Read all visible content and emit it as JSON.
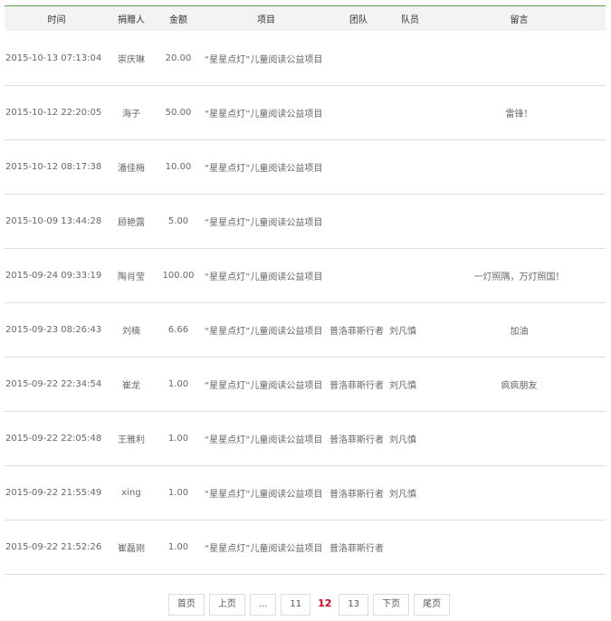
{
  "table": {
    "headers": {
      "time": "时间",
      "donor": "捐赠人",
      "amount": "金额",
      "project": "项目",
      "team": "团队",
      "member": "队员",
      "message": "留言"
    },
    "rows": [
      {
        "time": "2015-10-13 07:13:04",
        "donor": "崇庆琳",
        "amount": "20.00",
        "project": "“星星点灯”儿童阅读公益项目",
        "team": "",
        "member": "",
        "message": ""
      },
      {
        "time": "2015-10-12 22:20:05",
        "donor": "海子",
        "amount": "50.00",
        "project": "“星星点灯”儿童阅读公益项目",
        "team": "",
        "member": "",
        "message": "雷锋！"
      },
      {
        "time": "2015-10-12 08:17:38",
        "donor": "潘佳梅",
        "amount": "10.00",
        "project": "“星星点灯”儿童阅读公益项目",
        "team": "",
        "member": "",
        "message": ""
      },
      {
        "time": "2015-10-09 13:44:28",
        "donor": "顾艳露",
        "amount": "5.00",
        "project": "“星星点灯”儿童阅读公益项目",
        "team": "",
        "member": "",
        "message": ""
      },
      {
        "time": "2015-09-24 09:33:19",
        "donor": "陶肖莹",
        "amount": "100.00",
        "project": "“星星点灯”儿童阅读公益项目",
        "team": "",
        "member": "",
        "message": "一灯照隅，万灯照国！"
      },
      {
        "time": "2015-09-23 08:26:43",
        "donor": "刘楠",
        "amount": "6.66",
        "project": "“星星点灯”儿童阅读公益项目",
        "team": "普洛菲斯行者",
        "member": "刘凡慎",
        "message": "加油"
      },
      {
        "time": "2015-09-22 22:34:54",
        "donor": "崔龙",
        "amount": "1.00",
        "project": "“星星点灯”儿童阅读公益项目",
        "team": "普洛菲斯行者",
        "member": "刘凡慎",
        "message": "疯疯朋友"
      },
      {
        "time": "2015-09-22 22:05:48",
        "donor": "王雅利",
        "amount": "1.00",
        "project": "“星星点灯”儿童阅读公益项目",
        "team": "普洛菲斯行者",
        "member": "刘凡慎",
        "message": ""
      },
      {
        "time": "2015-09-22 21:55:49",
        "donor": "xing",
        "amount": "1.00",
        "project": "“星星点灯”儿童阅读公益项目",
        "team": "普洛菲斯行者",
        "member": "刘凡慎",
        "message": ""
      },
      {
        "time": "2015-09-22 21:52:26",
        "donor": "崔磊刚",
        "amount": "1.00",
        "project": "“星星点灯”儿童阅读公益项目",
        "team": "普洛菲斯行者",
        "member": "",
        "message": ""
      }
    ]
  },
  "pagination": {
    "first": "首页",
    "prev": "上页",
    "ellipsis": "...",
    "pages": [
      "11",
      "12",
      "13"
    ],
    "current": "12",
    "next": "下页",
    "last": "尾页"
  },
  "colors": {
    "accent_line": "#5aa34a",
    "current_page": "#d0021b",
    "header_bg": "#f3f3f3"
  }
}
